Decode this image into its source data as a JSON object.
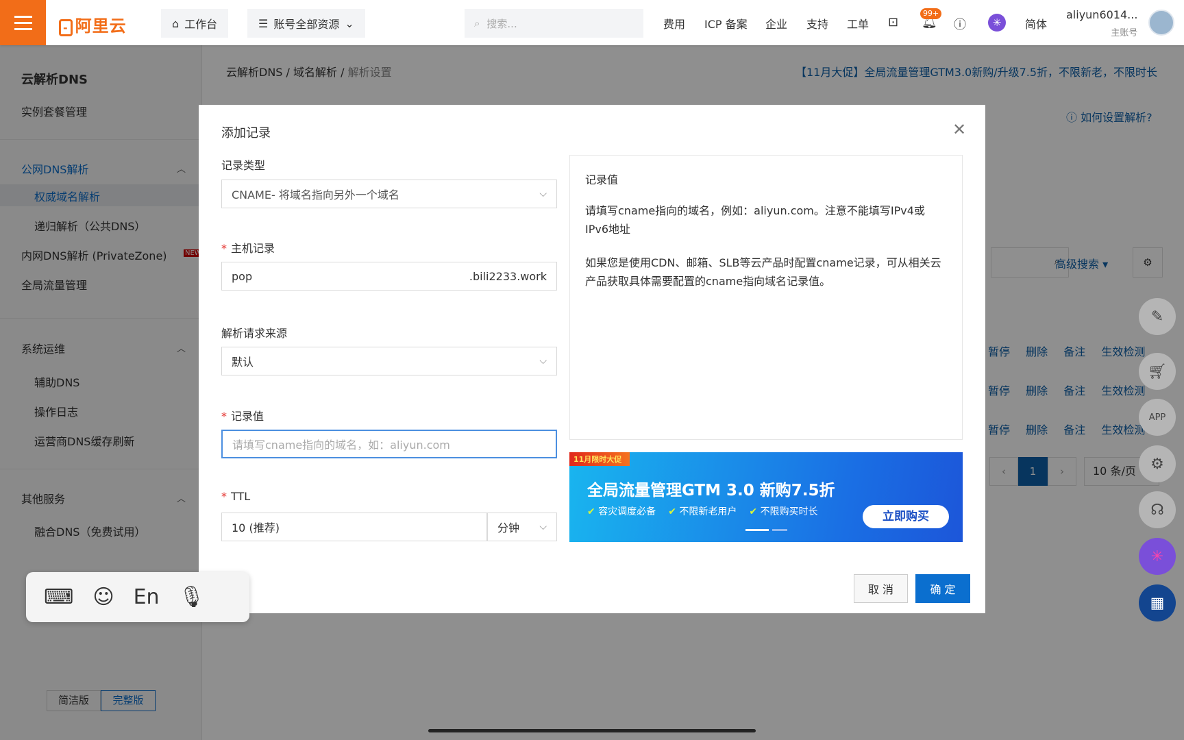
{
  "topbar": {
    "logo": "阿里云",
    "workbench": "工作台",
    "resources": "账号全部资源",
    "search_placeholder": "搜索...",
    "links": [
      "费用",
      "ICP 备案",
      "企业",
      "支持",
      "工单"
    ],
    "notification_badge": "99+",
    "language": "简体",
    "username": "aliyun6014...",
    "account_type": "主账号",
    "brand_color": "#f26d18"
  },
  "sidebar": {
    "title": "云解析DNS",
    "instance": "实例套餐管理",
    "public_dns": "公网DNS解析",
    "authoritative": "权威域名解析",
    "recursive": "递归解析（公共DNS）",
    "private_zone": "内网DNS解析 (PrivateZone)",
    "new_badge": "NEW",
    "gtm": "全局流量管理",
    "ops": "系统运维",
    "aux_dns": "辅助DNS",
    "op_log": "操作日志",
    "cache_refresh": "运营商DNS缓存刷新",
    "other": "其他服务",
    "fusion_dns": "融合DNS（免费试用）",
    "simple_version": "简洁版",
    "full_version": "完整版"
  },
  "background": {
    "breadcrumb": [
      "云解析DNS",
      "域名解析",
      "解析设置"
    ],
    "promo": "【11月大促】全局流量管理GTM3.0新购/升级7.5折，不限新老，不限时长",
    "help": "如何设置解析?",
    "advanced_search": "高级搜索",
    "row_actions": [
      "暂停",
      "删除",
      "备注",
      "生效检测"
    ],
    "page": "1",
    "page_size": "10 条/页"
  },
  "modal": {
    "title": "添加记录",
    "record_type_label": "记录类型",
    "record_type_value": "CNAME- 将域名指向另外一个域名",
    "host_label": "主机记录",
    "host_value": "pop",
    "host_suffix": ".bili2233.work",
    "source_label": "解析请求来源",
    "source_value": "默认",
    "value_label": "记录值",
    "value_placeholder": "请填写cname指向的域名，如：aliyun.com",
    "ttl_label": "TTL",
    "ttl_value": "10 (推荐)",
    "ttl_unit": "分钟",
    "cancel": "取 消",
    "confirm": "确 定",
    "help_panel": {
      "title": "记录值",
      "p1": "请填写cname指向的域名，例如：aliyun.com。注意不能填写IPv4或IPv6地址",
      "p2": "如果您是使用CDN、邮箱、SLB等云产品时配置cname记录，可从相关云产品获取具体需要配置的cname指向域名记录值。"
    },
    "banner": {
      "tag": "11月限时大促",
      "headline": "全局流量管理GTM 3.0 新购7.5折",
      "features": [
        "容灾调度必备",
        "不限新老用户",
        "不限购买时长"
      ],
      "cta": "立即购买"
    }
  },
  "keyboard": {
    "lang": "En"
  }
}
